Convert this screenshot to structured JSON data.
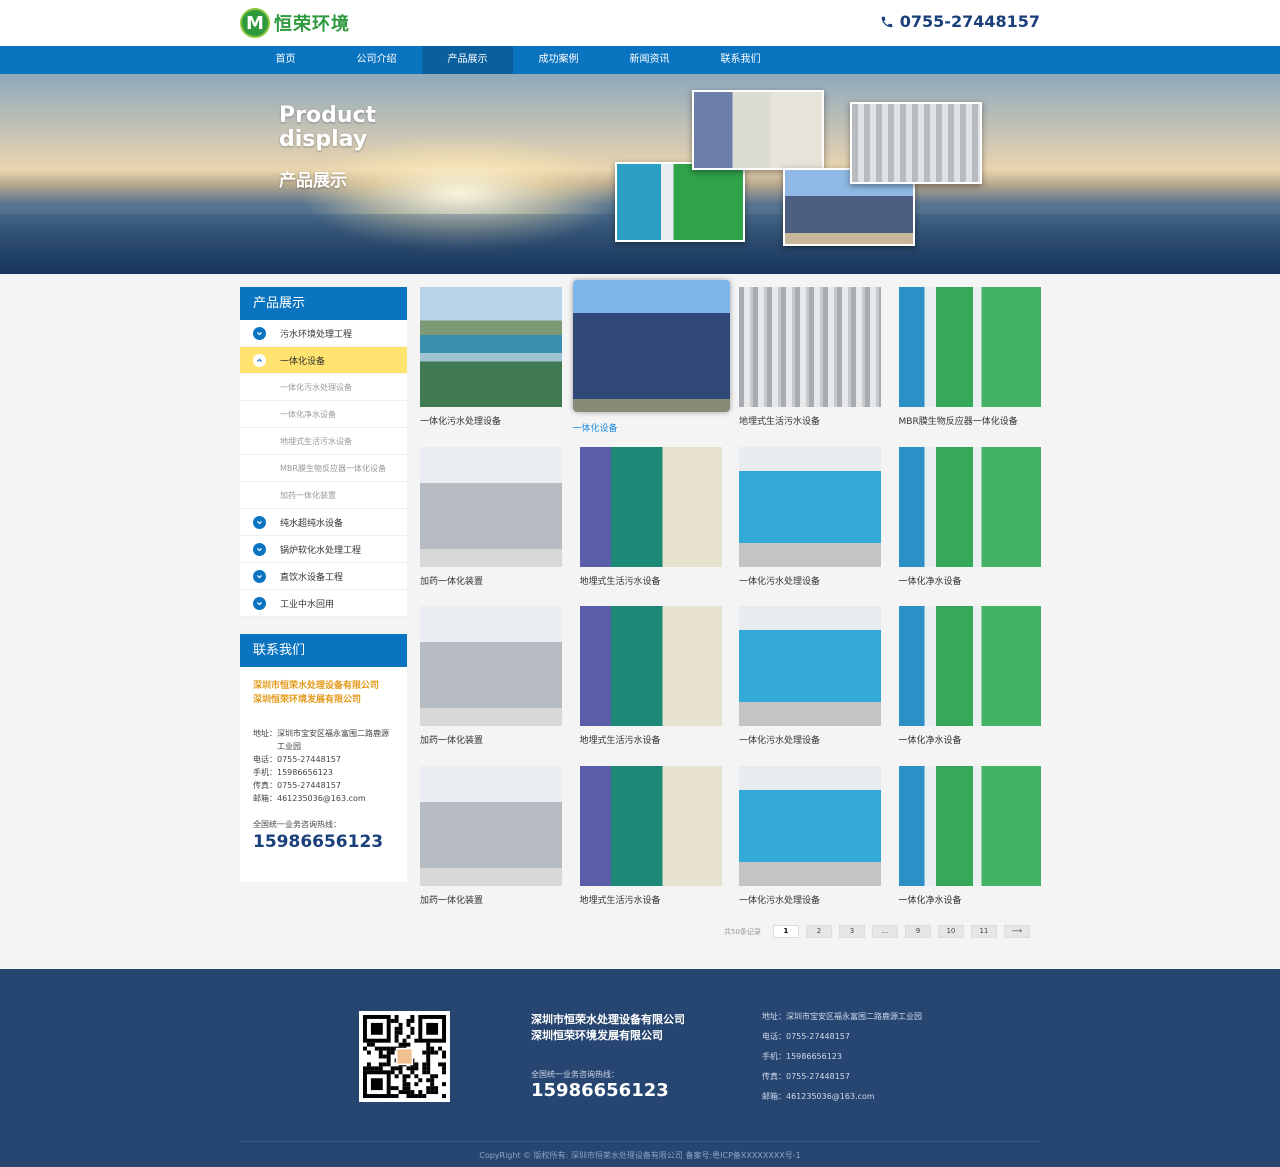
{
  "header": {
    "logo_text": "恒荣环境",
    "logo_mark": "M",
    "phone": "0755-27448157"
  },
  "nav": {
    "items": [
      "首页",
      "公司介绍",
      "产品展示",
      "成功案例",
      "新闻资讯",
      "联系我们"
    ],
    "active_index": 2
  },
  "banner": {
    "title_line1": "Product",
    "title_line2": "display",
    "subtitle": "产品展示"
  },
  "sidebar": {
    "products_title": "产品展示",
    "categories": [
      {
        "label": "污水环境处理工程"
      },
      {
        "label": "一体化设备"
      },
      {
        "label": "纯水超纯水设备"
      },
      {
        "label": "锅炉软化水处理工程"
      },
      {
        "label": "直饮水设备工程"
      },
      {
        "label": "工业中水回用"
      }
    ],
    "subcategories": [
      "一体化污水处理设备",
      "一体化净水设备",
      "地埋式生活污水设备",
      "MBR膜生物反应器一体化设备",
      "加药一体化装置"
    ],
    "contact_title": "联系我们",
    "contact": {
      "company1": "深圳市恒荣水处理设备有限公司",
      "company2": "深圳恒荣环境发展有限公司",
      "address_line1": "地址：深圳市宝安区福永富围二路鹿源",
      "address_line2": "工业园",
      "tel": "电话：0755-27448157",
      "mobile": "手机：15986656123",
      "fax": "传真：0755-27448157",
      "email": "邮箱：461235036@163.com",
      "hotline_label": "全国统一业务咨询热线：",
      "hotline": "15986656123"
    }
  },
  "products": [
    {
      "caption": "一体化污水处理设备",
      "kind": "plant"
    },
    {
      "caption": "一体化设备",
      "kind": "blue-tanks"
    },
    {
      "caption": "地埋式生活污水设备",
      "kind": "ro"
    },
    {
      "caption": "MBR膜生物反应器一体化设备",
      "kind": "green"
    },
    {
      "caption": "加药一体化装置",
      "kind": "room"
    },
    {
      "caption": "地埋式生活污水设备",
      "kind": "hall"
    },
    {
      "caption": "一体化污水处理设备",
      "kind": "cyan"
    },
    {
      "caption": "一体化净水设备",
      "kind": "green"
    },
    {
      "caption": "加药一体化装置",
      "kind": "room"
    },
    {
      "caption": "地埋式生活污水设备",
      "kind": "hall"
    },
    {
      "caption": "一体化污水处理设备",
      "kind": "cyan"
    },
    {
      "caption": "一体化净水设备",
      "kind": "green"
    },
    {
      "caption": "加药一体化装置",
      "kind": "room"
    },
    {
      "caption": "地埋式生活污水设备",
      "kind": "hall"
    },
    {
      "caption": "一体化污水处理设备",
      "kind": "cyan"
    },
    {
      "caption": "一体化净水设备",
      "kind": "green"
    }
  ],
  "pager": {
    "total": "共50条记录",
    "pages": [
      "1",
      "2",
      "3",
      "...",
      "9",
      "10",
      "11"
    ],
    "next": "⟶"
  },
  "footer": {
    "company1": "深圳市恒荣水处理设备有限公司",
    "company2": "深圳恒荣环境发展有限公司",
    "hotline_label": "全国统一业务咨询热线：",
    "hotline": "15986656123",
    "address": "地址：深圳市宝安区福永富围二路鹿源工业园",
    "tel": "电话：0755-27448157",
    "mobile": "手机：15986656123",
    "fax": "传真：0755-27448157",
    "email": "邮箱：461235036@163.com",
    "copyright": "CopyRight © 版权所有: 深圳市恒荣水处理设备有限公司    备案号:粤ICP备XXXXXXXX号-1"
  },
  "colors": {
    "brand_blue": "#0b74c0",
    "footer_navy": "#264571",
    "highlight_yellow": "#ffe36e",
    "logo_green": "#2f9a3d"
  }
}
